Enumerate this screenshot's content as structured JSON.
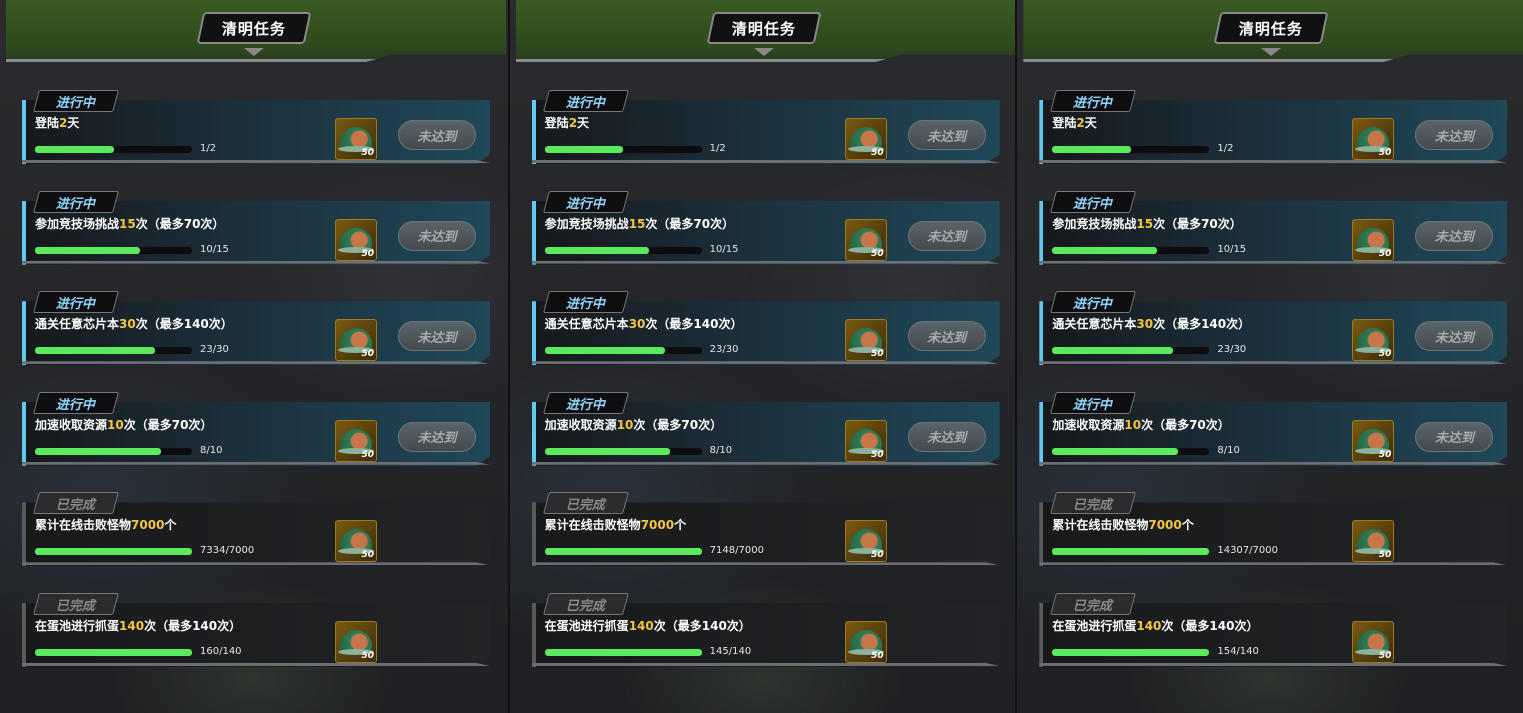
{
  "panels": [
    {
      "title": "清明任务",
      "tasks": [
        {
          "state": "active",
          "tag": "进行中",
          "desc": [
            "登陆",
            "2",
            "天",
            ""
          ],
          "progress": "1/2",
          "fraction": 0.5,
          "reward_qty": "50",
          "button": "未达到"
        },
        {
          "state": "active",
          "tag": "进行中",
          "desc": [
            "参加竞技场挑战",
            "15",
            "次（最多70次）",
            ""
          ],
          "progress": "10/15",
          "fraction": 0.667,
          "reward_qty": "50",
          "button": "未达到"
        },
        {
          "state": "active",
          "tag": "进行中",
          "desc": [
            "通关任意芯片本",
            "30",
            "次（最多140次）",
            ""
          ],
          "progress": "23/30",
          "fraction": 0.767,
          "reward_qty": "50",
          "button": "未达到"
        },
        {
          "state": "active",
          "tag": "进行中",
          "desc": [
            "加速收取资源",
            "10",
            "次（最多70次）",
            ""
          ],
          "progress": "8/10",
          "fraction": 0.8,
          "reward_qty": "50",
          "button": "未达到"
        },
        {
          "state": "done",
          "tag": "已完成",
          "desc": [
            "累计在线击败怪物",
            "7000",
            "个",
            ""
          ],
          "progress": "7334/7000",
          "fraction": 1,
          "reward_qty": "50",
          "button": ""
        },
        {
          "state": "done",
          "tag": "已完成",
          "desc": [
            "在蛋池进行抓蛋",
            "140",
            "次（最多140次）",
            ""
          ],
          "progress": "160/140",
          "fraction": 1,
          "reward_qty": "50",
          "button": ""
        }
      ]
    },
    {
      "title": "清明任务",
      "tasks": [
        {
          "state": "active",
          "tag": "进行中",
          "desc": [
            "登陆",
            "2",
            "天",
            ""
          ],
          "progress": "1/2",
          "fraction": 0.5,
          "reward_qty": "50",
          "button": "未达到"
        },
        {
          "state": "active",
          "tag": "进行中",
          "desc": [
            "参加竞技场挑战",
            "15",
            "次（最多70次）",
            ""
          ],
          "progress": "10/15",
          "fraction": 0.667,
          "reward_qty": "50",
          "button": "未达到"
        },
        {
          "state": "active",
          "tag": "进行中",
          "desc": [
            "通关任意芯片本",
            "30",
            "次（最多140次）",
            ""
          ],
          "progress": "23/30",
          "fraction": 0.767,
          "reward_qty": "50",
          "button": "未达到"
        },
        {
          "state": "active",
          "tag": "进行中",
          "desc": [
            "加速收取资源",
            "10",
            "次（最多70次）",
            ""
          ],
          "progress": "8/10",
          "fraction": 0.8,
          "reward_qty": "50",
          "button": "未达到"
        },
        {
          "state": "done",
          "tag": "已完成",
          "desc": [
            "累计在线击败怪物",
            "7000",
            "个",
            ""
          ],
          "progress": "7148/7000",
          "fraction": 1,
          "reward_qty": "50",
          "button": ""
        },
        {
          "state": "done",
          "tag": "已完成",
          "desc": [
            "在蛋池进行抓蛋",
            "140",
            "次（最多140次）",
            ""
          ],
          "progress": "145/140",
          "fraction": 1,
          "reward_qty": "50",
          "button": ""
        }
      ]
    },
    {
      "title": "清明任务",
      "tasks": [
        {
          "state": "active",
          "tag": "进行中",
          "desc": [
            "登陆",
            "2",
            "天",
            ""
          ],
          "progress": "1/2",
          "fraction": 0.5,
          "reward_qty": "50",
          "button": "未达到"
        },
        {
          "state": "active",
          "tag": "进行中",
          "desc": [
            "参加竞技场挑战",
            "15",
            "次（最多70次）",
            ""
          ],
          "progress": "10/15",
          "fraction": 0.667,
          "reward_qty": "50",
          "button": "未达到"
        },
        {
          "state": "active",
          "tag": "进行中",
          "desc": [
            "通关任意芯片本",
            "30",
            "次（最多140次）",
            ""
          ],
          "progress": "23/30",
          "fraction": 0.767,
          "reward_qty": "50",
          "button": "未达到"
        },
        {
          "state": "active",
          "tag": "进行中",
          "desc": [
            "加速收取资源",
            "10",
            "次（最多70次）",
            ""
          ],
          "progress": "8/10",
          "fraction": 0.8,
          "reward_qty": "50",
          "button": "未达到"
        },
        {
          "state": "done",
          "tag": "已完成",
          "desc": [
            "累计在线击败怪物",
            "7000",
            "个",
            ""
          ],
          "progress": "14307/7000",
          "fraction": 1,
          "reward_qty": "50",
          "button": ""
        },
        {
          "state": "done",
          "tag": "已完成",
          "desc": [
            "在蛋池进行抓蛋",
            "140",
            "次（最多140次）",
            ""
          ],
          "progress": "154/140",
          "fraction": 1,
          "reward_qty": "50",
          "button": ""
        }
      ]
    }
  ],
  "colors": {
    "highlight": "#f2c73f",
    "progress": "#5bea5b",
    "active_accent": "#62c9ee",
    "header_green": "#3b5a22"
  },
  "icons": {
    "reward": "helmet-icon",
    "header_arrow": "chevron-down-icon"
  }
}
